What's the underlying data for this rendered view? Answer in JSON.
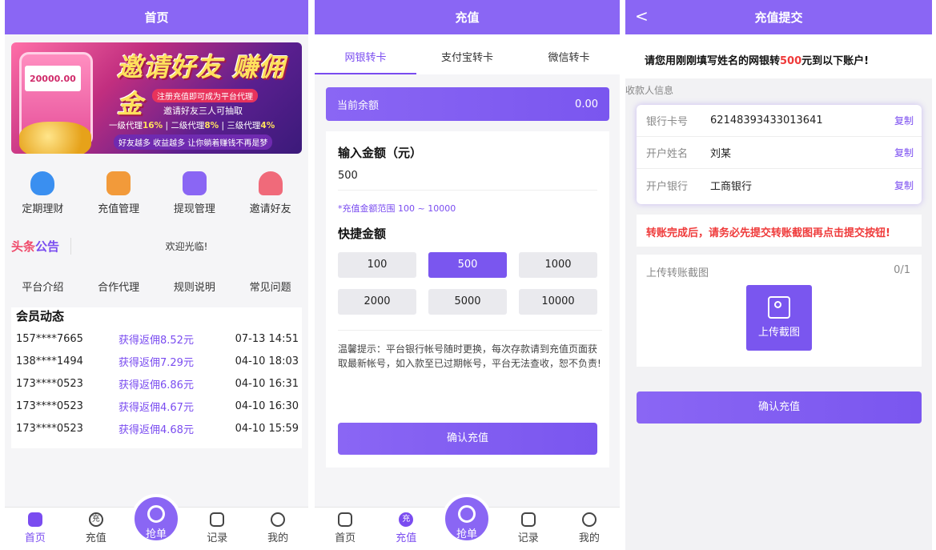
{
  "home": {
    "title": "首页",
    "banner": {
      "amount": "20000.00",
      "title": "邀请好友 赚佣金",
      "line1": "注册充值即可成为平台代理",
      "line2": "邀请好友三人可抽取",
      "line3_a": "一级代理",
      "line3_a_pct": "16%",
      "line3_b": "二级代理",
      "line3_b_pct": "8%",
      "line3_c": "三级代理",
      "line3_c_pct": "4%",
      "line4": "好友越多 收益越多 让你躺着赚钱不再是梦"
    },
    "quick": [
      {
        "label": "定期理财",
        "color": "#3a8ff0"
      },
      {
        "label": "充值管理",
        "color": "#f29a3a"
      },
      {
        "label": "提现管理",
        "color": "#8a66f4"
      },
      {
        "label": "邀请好友",
        "color": "#f06a7a"
      }
    ],
    "notice": {
      "logo_a": "头条",
      "logo_b": "公告",
      "text": "欢迎光临!"
    },
    "links": [
      "平台介绍",
      "合作代理",
      "规则说明",
      "常见问题"
    ],
    "member": {
      "title": "会员动态",
      "rows": [
        {
          "phone": "157****7665",
          "earn": "获得返佣8.52元",
          "time": "07-13 14:51"
        },
        {
          "phone": "138****1494",
          "earn": "获得返佣7.29元",
          "time": "04-10 18:03"
        },
        {
          "phone": "173****0523",
          "earn": "获得返佣6.86元",
          "time": "04-10 16:31"
        },
        {
          "phone": "173****0523",
          "earn": "获得返佣4.67元",
          "time": "04-10 16:30"
        },
        {
          "phone": "173****0523",
          "earn": "获得返佣4.68元",
          "time": "04-10 15:59"
        }
      ]
    }
  },
  "tabbar": {
    "home": "首页",
    "recharge": "充值",
    "recharge_icon": "充",
    "grab": "抢单",
    "records": "记录",
    "mine": "我的"
  },
  "recharge": {
    "title": "充值",
    "tabs": [
      "网银转卡",
      "支付宝转卡",
      "微信转卡"
    ],
    "balance_label": "当前余额",
    "balance_value": "0.00",
    "input_label": "输入金额（元）",
    "input_value": "500",
    "range": "*充值金额范围 100 ~ 10000",
    "quick_label": "快捷金额",
    "amounts": [
      "100",
      "500",
      "1000",
      "2000",
      "5000",
      "10000"
    ],
    "tip": "温馨提示：平台银行帐号随时更换，每次存款请到充值页面获取最新帐号，如入款至已过期帐号，平台无法查收，恕不负责!",
    "confirm": "确认充值"
  },
  "submit": {
    "title": "充值提交",
    "back": "<",
    "head_a": "请您用刚刚填写姓名的网银转",
    "head_amount": "500",
    "head_b": "元到以下账户!",
    "section": "收款人信息",
    "rows": [
      {
        "k": "银行卡号",
        "v": "62148393433013641",
        "c": "复制"
      },
      {
        "k": "开户姓名",
        "v": "刘某",
        "c": "复制"
      },
      {
        "k": "开户银行",
        "v": "工商银行",
        "c": "复制"
      }
    ],
    "warn": "转账完成后，请务必先提交转账截图再点击提交按钮!",
    "upload_label": "上传转账截图",
    "upload_count": "0/1",
    "upload_btn": "上传截图",
    "confirm": "确认充值"
  },
  "colors": {
    "primary": "#8a66f4",
    "accent": "#7a4cf0",
    "warn": "#ef3a3a"
  }
}
